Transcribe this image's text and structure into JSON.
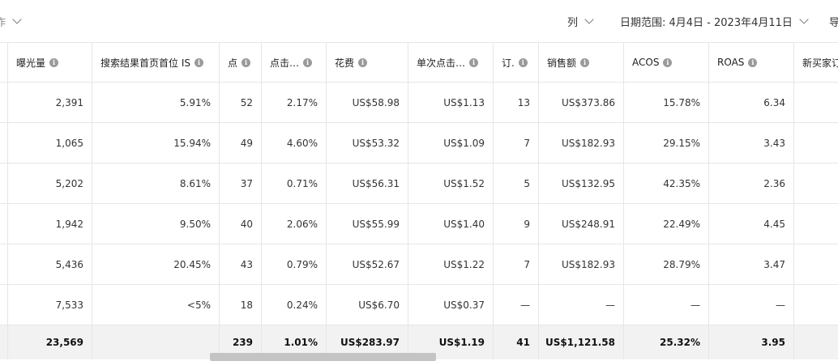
{
  "toolbar": {
    "actions_label": "作",
    "columns_label": "列",
    "date_range_label": "日期范围: 4月4日 - 2023年4月11日",
    "export_label": "导"
  },
  "table": {
    "headers": [
      "曝光量",
      "搜索结果首页首位 IS",
      "点",
      "点击…",
      "花费",
      "单次点击…",
      "订.",
      "销售额",
      "ACOS",
      "ROAS",
      "新买家订"
    ],
    "rows": [
      [
        "2,391",
        "5.91%",
        "52",
        "2.17%",
        "US$58.98",
        "US$1.13",
        "13",
        "US$373.86",
        "15.78%",
        "6.34",
        ""
      ],
      [
        "1,065",
        "15.94%",
        "49",
        "4.60%",
        "US$53.32",
        "US$1.09",
        "7",
        "US$182.93",
        "29.15%",
        "3.43",
        ""
      ],
      [
        "5,202",
        "8.61%",
        "37",
        "0.71%",
        "US$56.31",
        "US$1.52",
        "5",
        "US$132.95",
        "42.35%",
        "2.36",
        ""
      ],
      [
        "1,942",
        "9.50%",
        "40",
        "2.06%",
        "US$55.99",
        "US$1.40",
        "9",
        "US$248.91",
        "22.49%",
        "4.45",
        ""
      ],
      [
        "5,436",
        "20.45%",
        "43",
        "0.79%",
        "US$52.67",
        "US$1.22",
        "7",
        "US$182.93",
        "28.79%",
        "3.47",
        ""
      ],
      [
        "7,533",
        "<5%",
        "18",
        "0.24%",
        "US$6.70",
        "US$0.37",
        "—",
        "—",
        "—",
        "—",
        ""
      ]
    ],
    "totals": [
      "23,569",
      "",
      "239",
      "1.01%",
      "US$283.97",
      "US$1.19",
      "41",
      "US$1,121.58",
      "25.32%",
      "3.95",
      ""
    ]
  }
}
